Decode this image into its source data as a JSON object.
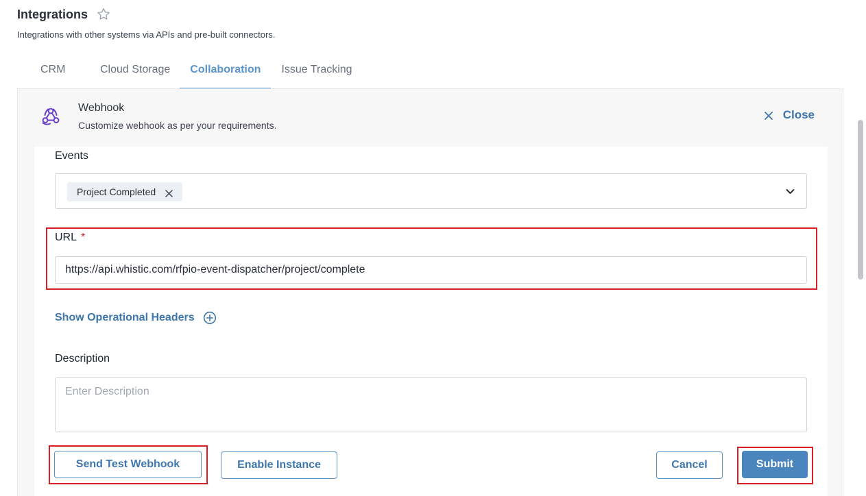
{
  "header": {
    "title": "Integrations",
    "subtitle": "Integrations with other systems via APIs and pre-built connectors."
  },
  "tabs": [
    {
      "label": "CRM",
      "active": false
    },
    {
      "label": "Cloud Storage",
      "active": false
    },
    {
      "label": "Collaboration",
      "active": true
    },
    {
      "label": "Issue Tracking",
      "active": false
    }
  ],
  "panel": {
    "title": "Webhook",
    "description": "Customize webhook as per your requirements.",
    "close_label": "Close"
  },
  "form": {
    "events_label": "Events",
    "events_selected": [
      "Project Completed"
    ],
    "url_label": "URL",
    "url_required_mark": "*",
    "url_value": "https://api.whistic.com/rfpio-event-dispatcher/project/complete",
    "operational_headers_label": "Show Operational Headers",
    "description_label": "Description",
    "description_placeholder": "Enter Description",
    "description_value": ""
  },
  "buttons": {
    "send_test": "Send Test Webhook",
    "enable_instance": "Enable Instance",
    "cancel": "Cancel",
    "submit": "Submit"
  },
  "colors": {
    "accent": "#4a86bd",
    "link": "#3d77ad",
    "highlight": "#d81f26",
    "icon_purple": "#6a3fc8"
  },
  "icons": {
    "favorite": "star-outline-icon",
    "webhook": "webhook-icon",
    "close": "close-icon",
    "chip_remove": "close-icon",
    "dropdown": "chevron-down-icon",
    "add": "plus-circle-icon"
  }
}
